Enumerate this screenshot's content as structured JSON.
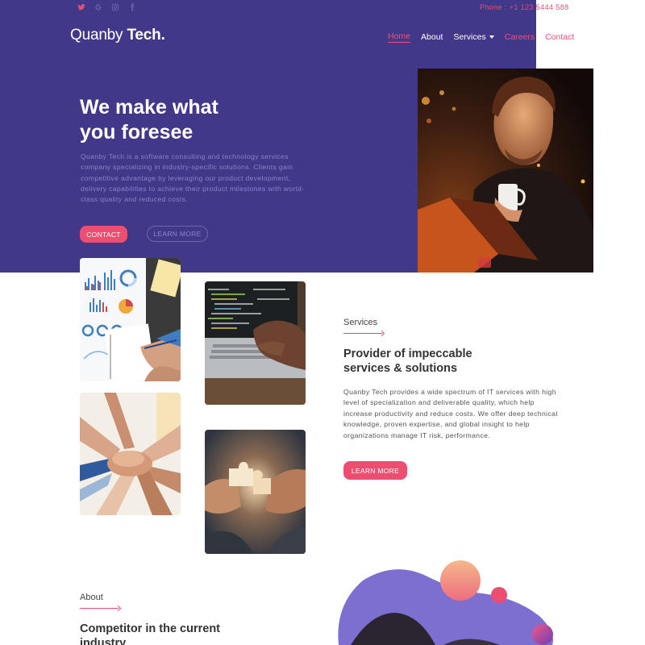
{
  "topbar": {
    "social_icons": [
      "twitter-icon",
      "google-icon",
      "instagram-icon",
      "facebook-icon"
    ],
    "phone": "Phone : +1 123 5444 588"
  },
  "logo": {
    "name_light": "Quanby ",
    "name_bold": "Tech."
  },
  "nav": {
    "items": [
      {
        "label": "Home",
        "active": true
      },
      {
        "label": "About"
      },
      {
        "label": "Services",
        "dropdown": true
      },
      {
        "label": "Careers"
      },
      {
        "label": "Contact"
      }
    ]
  },
  "hero": {
    "title_line1": "We make what",
    "title_line2": "you foresee",
    "description": "Quanby Tech is a software consulting and technology services company specializing in industry-specific solutions. Clients gain competitive advantage by leveraging our product development, delivery capabilities to achieve their product milestones with world-class quality and reduced costs.",
    "contact_button": "CONTACT",
    "learn_button": "LEARN MORE"
  },
  "services": {
    "label": "Services",
    "title_line1": "Provider of impeccable",
    "title_line2": "services & solutions",
    "description": "Quanby Tech provides a wide spectrum of IT services with high level of specialization and deliverable quality, which help increase productivity and reduce costs. We offer deep technical knowledge, proven expertise, and global insight to help organizations manage IT risk, performance.",
    "button": "LEARN MORE"
  },
  "about": {
    "label": "About",
    "title_line1": "Competitor in the current",
    "title_line2": "industry"
  },
  "colors": {
    "hero_bg": "#42388a",
    "accent": "#ec4e72",
    "blob": "#7c6fd0"
  }
}
